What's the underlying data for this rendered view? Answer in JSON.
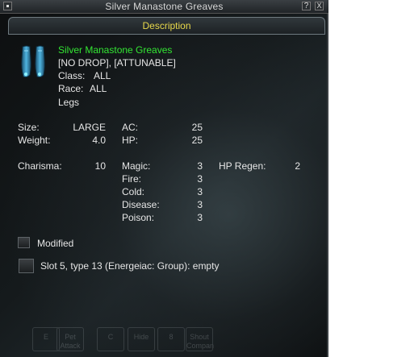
{
  "window": {
    "title": "Silver Manastone Greaves",
    "help_label": "?",
    "close_label": "X",
    "tab_label": "Description"
  },
  "item": {
    "icon": "greaves-icon",
    "name": "Silver Manastone Greaves",
    "flags": "[NO DROP], [ATTUNABLE]",
    "class_label": "Class:",
    "class_value": "ALL",
    "race_label": "Race:",
    "race_value": "ALL",
    "slot": "Legs"
  },
  "stats": {
    "size_label": "Size:",
    "size_value": "LARGE",
    "weight_label": "Weight:",
    "weight_value": "4.0",
    "ac_label": "AC:",
    "ac_value": "25",
    "hp_label": "HP:",
    "hp_value": "25",
    "charisma_label": "Charisma:",
    "charisma_value": "10",
    "magic_label": "Magic:",
    "magic_value": "3",
    "fire_label": "Fire:",
    "fire_value": "3",
    "cold_label": "Cold:",
    "cold_value": "3",
    "disease_label": "Disease:",
    "disease_value": "3",
    "poison_label": "Poison:",
    "poison_value": "3",
    "hp_regen_label": "HP Regen:",
    "hp_regen_value": "2"
  },
  "modified": {
    "label": "Modified",
    "checked": false
  },
  "augment_slot": {
    "label": "Slot 5, type 13 (Energeiac: Group): empty"
  },
  "hotbar": {
    "buttons": [
      "E",
      "Pet Attack",
      "C",
      "Hide",
      "8",
      "Shout Compan"
    ]
  },
  "colors": {
    "item_name": "#33e633",
    "tab_label": "#e8d84a",
    "text": "#e6e6e6"
  }
}
